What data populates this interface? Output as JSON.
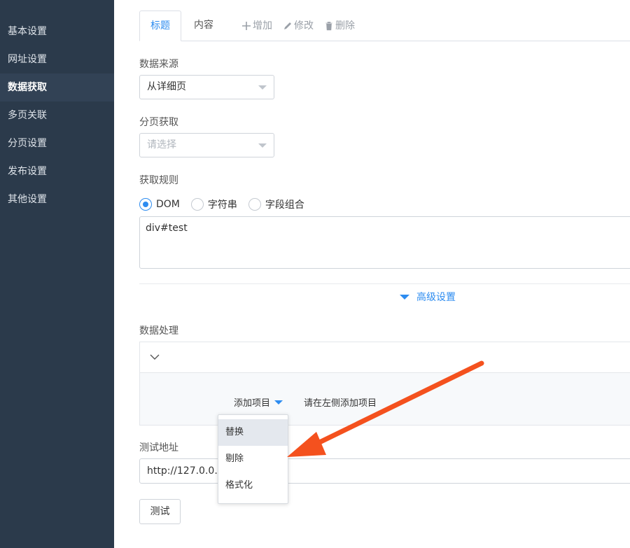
{
  "sidebar": {
    "items": [
      {
        "label": "基本设置"
      },
      {
        "label": "网址设置"
      },
      {
        "label": "数据获取"
      },
      {
        "label": "多页关联"
      },
      {
        "label": "分页设置"
      },
      {
        "label": "发布设置"
      },
      {
        "label": "其他设置"
      }
    ],
    "active_index": 2
  },
  "tabs": {
    "title_tab": "标题",
    "content_tab": "内容",
    "add": "增加",
    "edit": "修改",
    "delete": "删除"
  },
  "form": {
    "data_source_label": "数据来源",
    "data_source_value": "从详细页",
    "paging_label": "分页获取",
    "paging_placeholder": "请选择",
    "rule_label": "获取规则",
    "rule_options": [
      "DOM",
      "字符串",
      "字段组合"
    ],
    "rule_selected": "DOM",
    "rule_value": "div#test",
    "advanced_label": "高级设置",
    "processing_label": "数据处理",
    "add_item_label": "添加项目",
    "add_item_hint": "请在左侧添加项目",
    "test_url_label": "测试地址",
    "test_url_value": "http://127.0.0.1/",
    "test_button": "测试"
  },
  "dropdown": {
    "items": [
      "替换",
      "剔除",
      "格式化"
    ],
    "highlighted": "替换"
  },
  "colors": {
    "sidebar_bg": "#2b3a4b",
    "accent": "#2d8cf0",
    "annotation_arrow": "#f4511e"
  }
}
